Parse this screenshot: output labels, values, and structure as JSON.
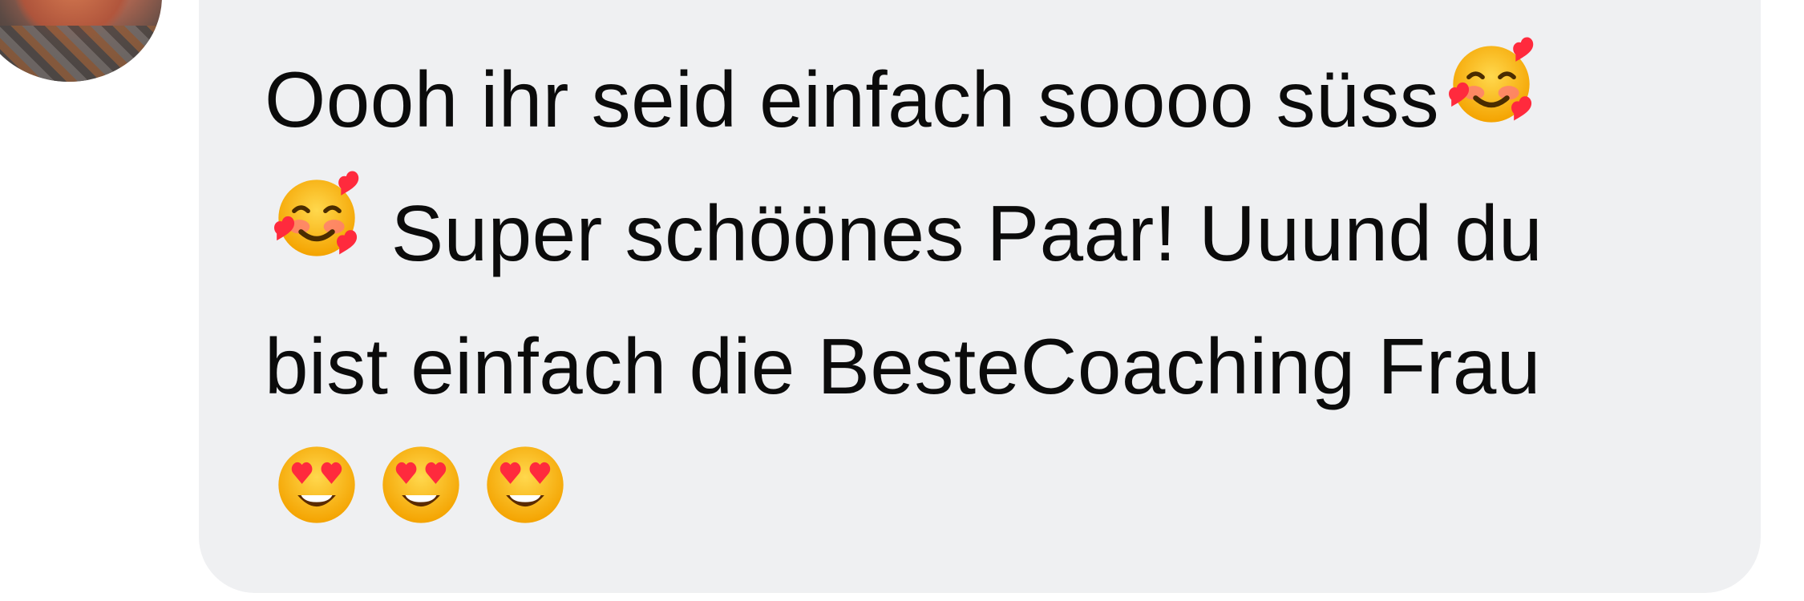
{
  "comment": {
    "avatar_icon": "user-avatar",
    "lines": [
      "Oooh ihr seid einfach soooo süss🥰",
      "🥰 Super schöönes Paar! Uuund du",
      "bist einfach die BesteCoaching Frau",
      "😍😍😍"
    ],
    "segments": {
      "line1_text": "Oooh ihr seid einfach soooo süss",
      "line2_text": " Super schöönes Paar! Uuund du",
      "line3_text": "bist einfach die BesteCoaching Frau"
    },
    "emojis": [
      "smiling-face-with-hearts",
      "smiling-face-with-hearts",
      "heart-eyes",
      "heart-eyes",
      "heart-eyes"
    ],
    "bubble_color": "#eff0f2",
    "text_color": "#0b0b0b"
  }
}
